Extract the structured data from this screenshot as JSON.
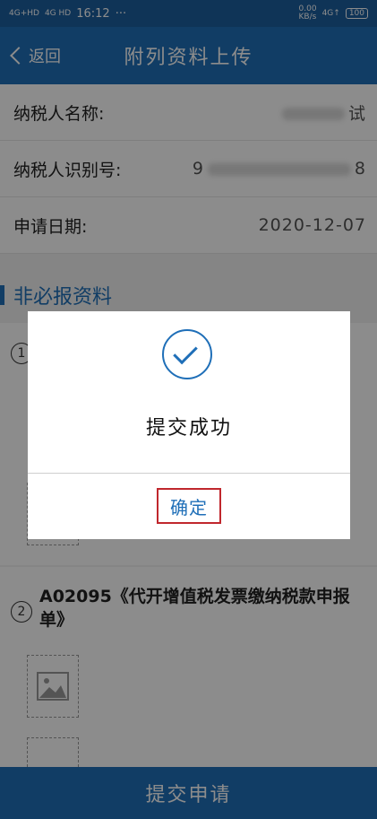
{
  "status_bar": {
    "signal_1": "4G+HD",
    "signal_2": "4G HD",
    "time": "16:12",
    "more": "···",
    "speed": "0.00",
    "speed_unit": "KB/s",
    "net": "4G↑",
    "battery": "100"
  },
  "nav": {
    "back_label": "返回",
    "title": "附列资料上传"
  },
  "info_rows": [
    {
      "label": "纳税人名称:",
      "value": "试"
    },
    {
      "label": "纳税人识别号:",
      "value_prefix": "9",
      "value_suffix": "8"
    },
    {
      "label": "申请日期:",
      "value": "2020-12-07"
    }
  ],
  "section": {
    "title": "非必报资料"
  },
  "items": [
    {
      "num": "1"
    },
    {
      "num": "2",
      "title": "A02095《代开增值税发票缴纳税款申报单》"
    }
  ],
  "submit_label": "提交申请",
  "dialog": {
    "message": "提交成功",
    "confirm_label": "确定"
  },
  "colors": {
    "primary": "#1f6fb8",
    "status_bar": "#1d5f9f",
    "confirm_border": "#c0272d"
  }
}
